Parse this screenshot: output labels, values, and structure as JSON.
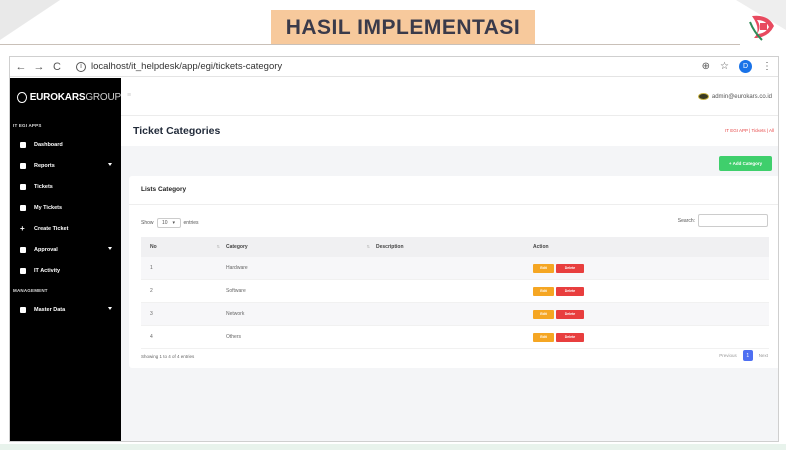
{
  "slide": {
    "title": "HASIL IMPLEMENTASI",
    "accent": "#f7c99c"
  },
  "browser": {
    "back_icon": "←",
    "forward_icon": "→",
    "reload_icon": "C",
    "info_icon": "i",
    "url": "localhost/it_helpdesk/app/egi/tickets-category",
    "zoom_icon": "⊕",
    "star_icon": "☆",
    "profile_initial": "D",
    "menu_icon": "⋮"
  },
  "sidebar": {
    "brand_bold": "EUROKARS",
    "brand_thin": "GROUP",
    "section1": "IT EGI APPS",
    "items": [
      {
        "label": "Dashboard",
        "icon": "dashboard-icon",
        "caret": false
      },
      {
        "label": "Reports",
        "icon": "reports-icon",
        "caret": true
      },
      {
        "label": "Tickets",
        "icon": "tickets-icon",
        "caret": false
      },
      {
        "label": "My Tickets",
        "icon": "my-tickets-icon",
        "caret": false
      },
      {
        "label": "Create Ticket",
        "icon": "plus-icon",
        "caret": false
      },
      {
        "label": "Approval",
        "icon": "approval-icon",
        "caret": true
      },
      {
        "label": "IT Activity",
        "icon": "activity-icon",
        "caret": false
      }
    ],
    "section2": "MANAGEMENT",
    "items2": [
      {
        "label": "Master Data",
        "icon": "master-data-icon",
        "caret": true
      }
    ],
    "background": "#000000"
  },
  "topbar": {
    "menu_icon": "≡",
    "user_email": "admin@eurokars.co.id"
  },
  "header": {
    "title": "Ticket Categories",
    "breadcrumb": "IT EGI APP  |  Tickets  |  All",
    "add_button": "+ Add Category",
    "add_color": "#3fcf6c"
  },
  "card": {
    "title": "Lists Category",
    "show_label": "Show",
    "length_value": "10",
    "length_caret": "▾",
    "entries_label": "entries",
    "search_label": "Search:",
    "search_value": ""
  },
  "table": {
    "columns": [
      "No",
      "Category",
      "Description",
      "Action"
    ],
    "sort_icon": "⇅",
    "rows": [
      {
        "no": "1",
        "category": "Hardware",
        "description": ""
      },
      {
        "no": "2",
        "category": "Software",
        "description": ""
      },
      {
        "no": "3",
        "category": "Network",
        "description": ""
      },
      {
        "no": "4",
        "category": "Others",
        "description": ""
      }
    ],
    "edit_label": "Edit",
    "delete_label": "Delete",
    "edit_color": "#f5a623",
    "delete_color": "#e83e3e"
  },
  "footer": {
    "info": "Showing 1 to 4 of 4 entries",
    "previous": "Previous",
    "page": "1",
    "next": "Next"
  }
}
